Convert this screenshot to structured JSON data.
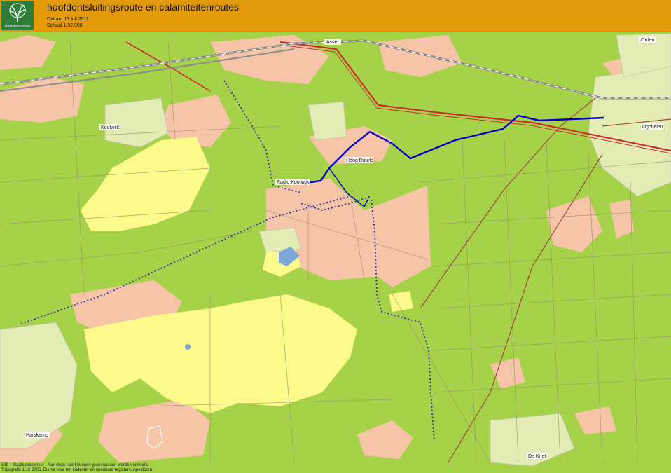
{
  "header": {
    "logo_text": "staatsbosbeheer",
    "title": "hoofdontsluitingsroute en calamiteitenroutes",
    "date_line": "Datum: 13 juli 2011",
    "scale_line": "Schaal 1:32,950"
  },
  "places": {
    "assel": "Assel",
    "orden": "Orden",
    "kootwijk": "Kootwijk",
    "hoog_buurlo": "Hoog Buurlo",
    "radio_kootwijk": "Radio Kootwijk",
    "ugchelen": "Ugchelen",
    "harskamp": "Harskamp",
    "de_kriet": "De Kriet"
  },
  "footer": {
    "line1": "GIS - Staatsbosbeheer - Aan deze kaart kunnen geen rechten worden ontleend",
    "line2": "Topografie 1:10 2006, Dienst voor het kadaster en openbare registers, Apeldoorn"
  },
  "colors": {
    "header": "#e39a0a",
    "forest": "#a6d24a",
    "heath": "#f6c4a6",
    "sand": "#fdf98a",
    "main_route": "#0000c8",
    "emergency_route": "#2a2aa8",
    "railway": "#b0b0b0",
    "highway": "#c8302a"
  }
}
